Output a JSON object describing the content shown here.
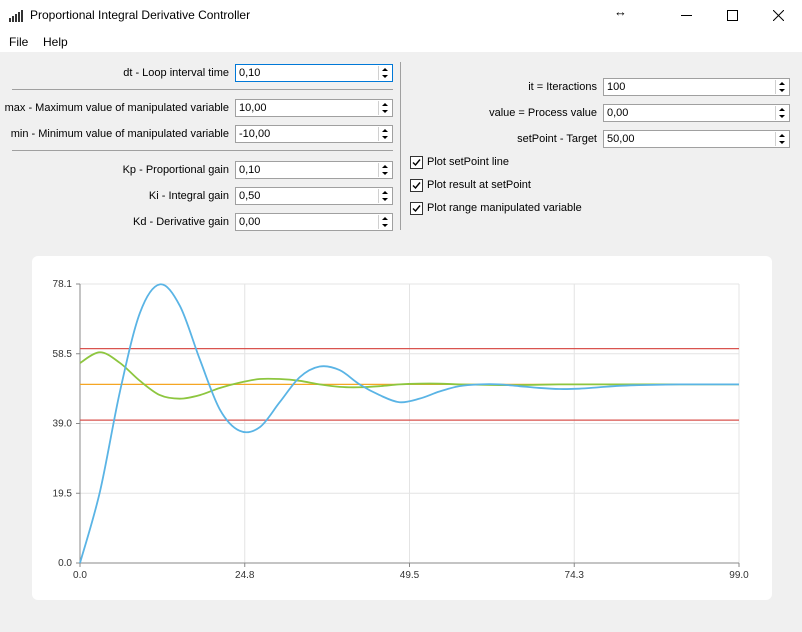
{
  "window": {
    "title": "Proportional Integral Derivative Controller",
    "resize_glyph": "↔"
  },
  "menu": {
    "file": "File",
    "help": "Help"
  },
  "left_params": [
    {
      "label": "dt - Loop interval time",
      "value": "0,10"
    },
    {
      "label": "max - Maximum value of manipulated variable",
      "value": "10,00"
    },
    {
      "label": "min - Minimum value of manipulated variable",
      "value": "-10,00"
    },
    {
      "label": "Kp - Proportional gain",
      "value": "0,10"
    },
    {
      "label": "Ki - Integral gain",
      "value": "0,50"
    },
    {
      "label": "Kd - Derivative gain",
      "value": "0,00"
    }
  ],
  "right_params": [
    {
      "label": "it = Iteractions",
      "value": "100"
    },
    {
      "label": "value = Process value",
      "value": "0,00"
    },
    {
      "label": "setPoint - Target",
      "value": "50,00"
    }
  ],
  "checkboxes": [
    {
      "label": "Plot setPoint line",
      "checked": true
    },
    {
      "label": "Plot result at setPoint",
      "checked": true
    },
    {
      "label": "Plot range manipulated variable",
      "checked": true
    }
  ],
  "colors": {
    "process": "#5ab4e5",
    "result": "#8dc63f",
    "setpoint": "#f5a623",
    "range": "#d9534f",
    "accent": "#0078d7"
  },
  "chart_data": {
    "type": "line",
    "xlim": [
      0.0,
      99.0
    ],
    "ylim": [
      0.0,
      78.1
    ],
    "xticks": [
      "0.0",
      "24.8",
      "49.5",
      "74.3",
      "99.0"
    ],
    "yticks": [
      "0.0",
      "19.5",
      "39.0",
      "58.5",
      "78.1"
    ],
    "grid": true,
    "series": [
      {
        "color": "#5ab4e5",
        "x": [
          0,
          3,
          6,
          9,
          12,
          15,
          18,
          21,
          24,
          27,
          30,
          33,
          36,
          39,
          42,
          45,
          48,
          51,
          54,
          57,
          60,
          63,
          66,
          69,
          72,
          75,
          78,
          81,
          84,
          87,
          90,
          93,
          96,
          99
        ],
        "y": [
          0,
          20,
          48,
          70,
          78,
          72,
          57,
          43,
          37,
          38,
          45,
          52,
          55,
          54,
          50,
          47,
          45,
          46,
          48,
          49.5,
          50,
          50,
          49.5,
          49,
          48.7,
          48.8,
          49.2,
          49.6,
          49.8,
          49.9,
          50,
          50,
          50,
          50
        ]
      },
      {
        "color": "#8dc63f",
        "x": [
          0,
          3,
          6,
          9,
          12,
          15,
          18,
          21,
          24,
          27,
          30,
          33,
          36,
          39,
          42,
          45,
          48,
          51,
          54,
          57,
          60,
          63,
          66,
          69,
          72,
          75,
          78,
          81,
          84,
          87,
          90,
          93,
          96,
          99
        ],
        "y": [
          56,
          59,
          56,
          51,
          47,
          46,
          47,
          49,
          50.5,
          51.5,
          51.5,
          51,
          50,
          49.3,
          49.2,
          49.5,
          50,
          50.2,
          50.2,
          50,
          49.9,
          49.8,
          49.8,
          49.9,
          50,
          50,
          50,
          50,
          50,
          50,
          50,
          50,
          50,
          50
        ]
      },
      {
        "color": "#f5a623",
        "x": [
          0,
          99
        ],
        "y": [
          50,
          50
        ]
      },
      {
        "color": "#d9534f",
        "x": [
          0,
          99
        ],
        "y": [
          60,
          60
        ]
      },
      {
        "color": "#d9534f",
        "x": [
          0,
          99
        ],
        "y": [
          40,
          40
        ]
      }
    ]
  }
}
